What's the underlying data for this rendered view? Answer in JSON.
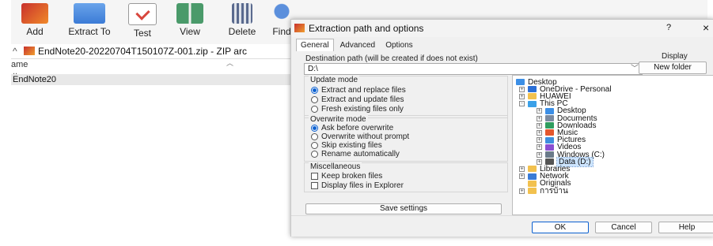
{
  "toolbar": {
    "items": [
      {
        "label": "Add",
        "color": "#c8302c"
      },
      {
        "label": "Extract To",
        "color": "#3b7bd6"
      },
      {
        "label": "Test",
        "color": "#d8473e"
      },
      {
        "label": "View",
        "color": "#4a9a6a"
      },
      {
        "label": "Delete",
        "color": "#5a6a8e"
      },
      {
        "label": "Find",
        "color": "#2f5fb0"
      }
    ]
  },
  "address": {
    "path": "EndNote20-20220704T150107Z-001.zip - ZIP arc"
  },
  "filelist": {
    "column_name": "ame",
    "parent": "..",
    "rows": [
      "EndNote20"
    ]
  },
  "dialog": {
    "title": "Extraction path and options",
    "help_glyph": "?",
    "close_glyph": "×",
    "tabs": [
      "General",
      "Advanced",
      "Options"
    ],
    "dest_label": "Destination path (will be created if does not exist)",
    "dest_value": "D:\\",
    "display_button": "Display",
    "new_folder_button": "New folder",
    "update_mode": {
      "title": "Update mode",
      "options": [
        "Extract and replace files",
        "Extract and update files",
        "Fresh existing files only"
      ],
      "selected": 0
    },
    "overwrite_mode": {
      "title": "Overwrite mode",
      "options": [
        "Ask before overwrite",
        "Overwrite without prompt",
        "Skip existing files",
        "Rename automatically"
      ],
      "selected": 0
    },
    "misc": {
      "title": "Miscellaneous",
      "options": [
        "Keep broken files",
        "Display files in Explorer"
      ]
    },
    "save_settings": "Save settings",
    "tree": [
      {
        "label": "Desktop",
        "level": 0,
        "icon": "desktop-icon",
        "color": "#3c8fe6",
        "exp": ""
      },
      {
        "label": "OneDrive - Personal",
        "level": 1,
        "icon": "cloud-icon",
        "color": "#2b6fd6",
        "exp": "+"
      },
      {
        "label": "HUAWEI",
        "level": 1,
        "icon": "folder-icon",
        "color": "#f2c14e",
        "exp": "+"
      },
      {
        "label": "This PC",
        "level": 1,
        "icon": "computer-icon",
        "color": "#3aa0e8",
        "exp": "-"
      },
      {
        "label": "Desktop",
        "level": 2,
        "icon": "desktop-icon",
        "color": "#3c8fe6",
        "exp": "+"
      },
      {
        "label": "Documents",
        "level": 2,
        "icon": "documents-icon",
        "color": "#7a8aa0",
        "exp": "+"
      },
      {
        "label": "Downloads",
        "level": 2,
        "icon": "downloads-icon",
        "color": "#2f9d5f",
        "exp": "+"
      },
      {
        "label": "Music",
        "level": 2,
        "icon": "music-icon",
        "color": "#e4572e",
        "exp": "+"
      },
      {
        "label": "Pictures",
        "level": 2,
        "icon": "pictures-icon",
        "color": "#3e8ede",
        "exp": "+"
      },
      {
        "label": "Videos",
        "level": 2,
        "icon": "videos-icon",
        "color": "#8a4fd1",
        "exp": "+"
      },
      {
        "label": "Windows (C:)",
        "level": 2,
        "icon": "drive-icon",
        "color": "#6a7a8a",
        "exp": "+"
      },
      {
        "label": "Data (D:)",
        "level": 2,
        "icon": "drive-icon",
        "color": "#555555",
        "exp": "+",
        "selected": true
      },
      {
        "label": "Libraries",
        "level": 1,
        "icon": "folder-icon",
        "color": "#f2c14e",
        "exp": "+"
      },
      {
        "label": "Network",
        "level": 1,
        "icon": "network-icon",
        "color": "#3a7bd5",
        "exp": "+"
      },
      {
        "label": "Originals",
        "level": 1,
        "icon": "folder-icon",
        "color": "#f2c14e",
        "exp": ""
      },
      {
        "label": "การบ้าน",
        "level": 1,
        "icon": "folder-icon",
        "color": "#f2c14e",
        "exp": "+"
      }
    ],
    "ok": "OK",
    "cancel": "Cancel",
    "help": "Help",
    "accent": "#0a5fd0",
    "selection_color": "#cce4ff"
  }
}
